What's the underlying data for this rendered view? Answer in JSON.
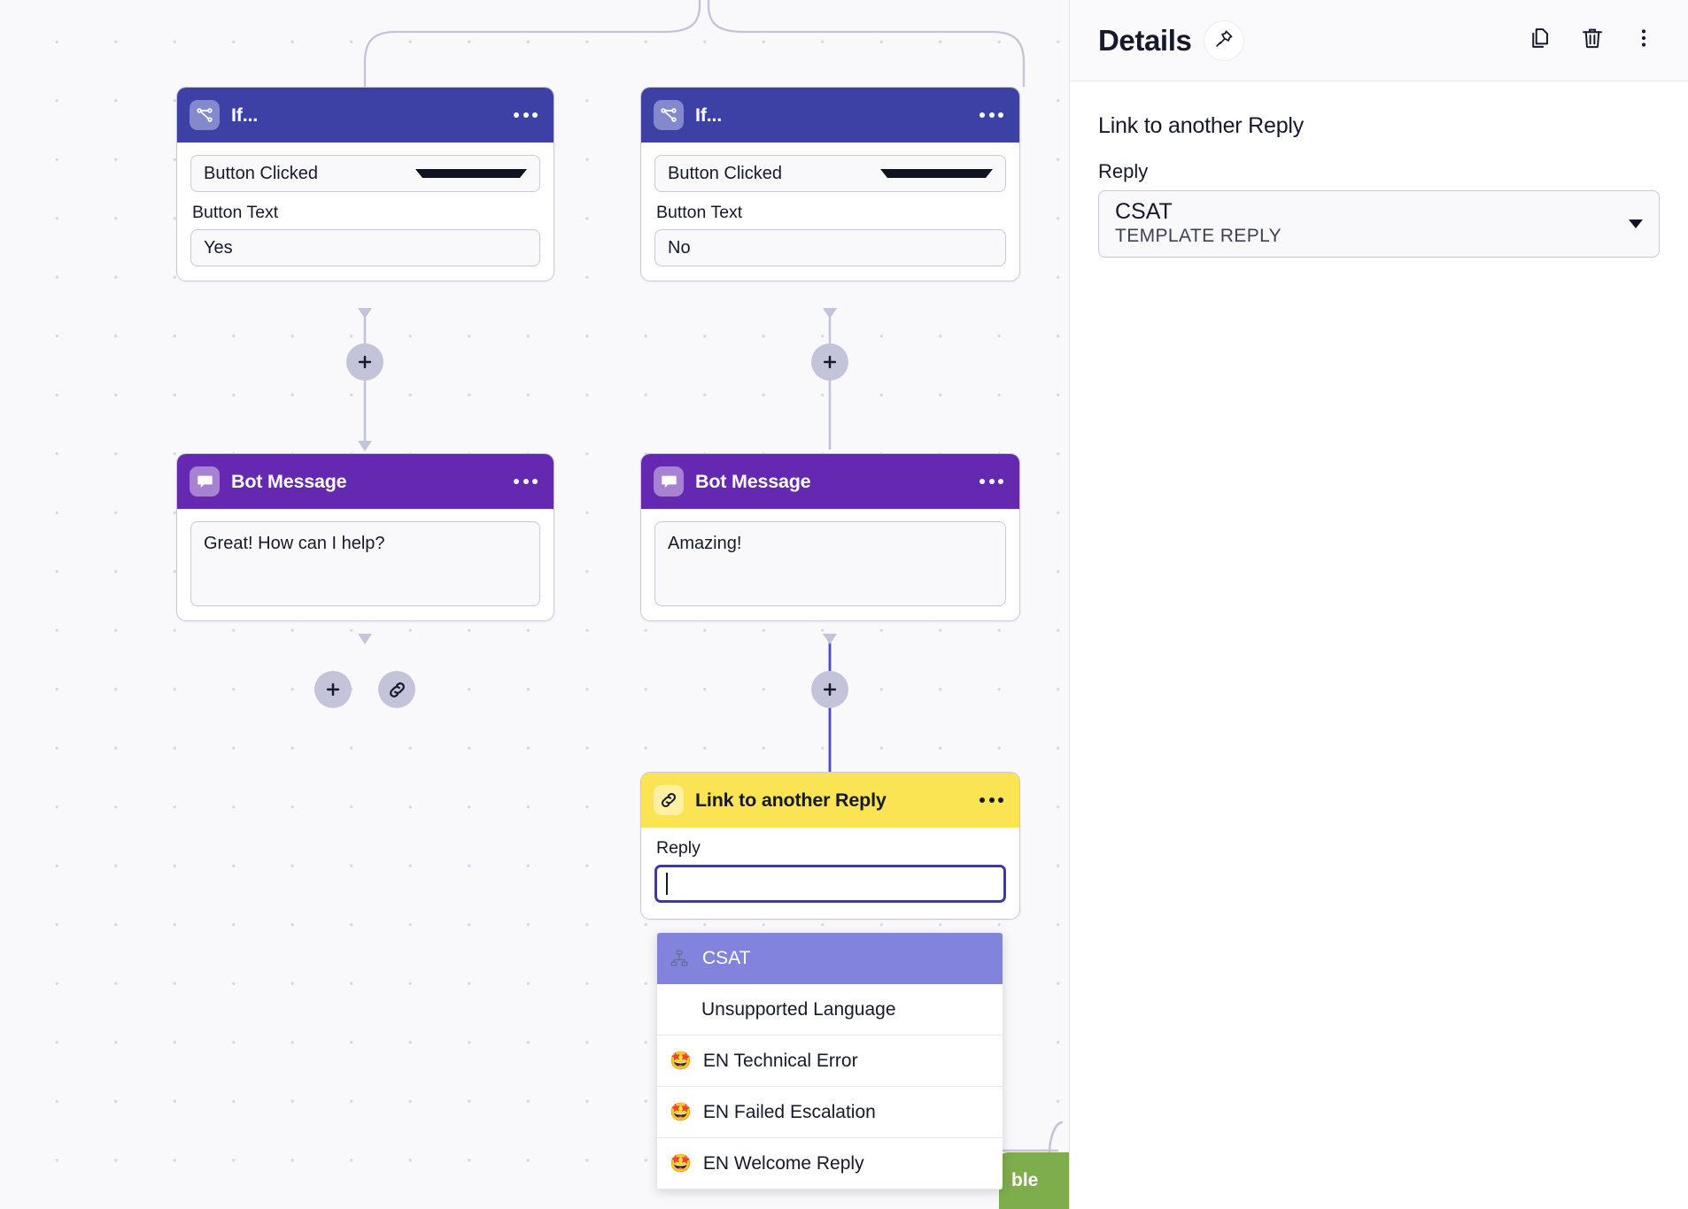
{
  "canvas": {
    "nodes": [
      {
        "id": "if-yes",
        "type": "if",
        "icon": "branch-icon",
        "title": "If...",
        "menu_icon": "more-horizontal-icon",
        "condition_value": "Button Clicked",
        "field_label": "Button Text",
        "field_value": "Yes"
      },
      {
        "id": "if-no",
        "type": "if",
        "icon": "branch-icon",
        "title": "If...",
        "menu_icon": "more-horizontal-icon",
        "condition_value": "Button Clicked",
        "field_label": "Button Text",
        "field_value": "No"
      },
      {
        "id": "bot-left",
        "type": "bot",
        "icon": "chat-bubble-icon",
        "title": "Bot Message",
        "menu_icon": "more-horizontal-icon",
        "message": "Great! How can I help?"
      },
      {
        "id": "bot-right",
        "type": "bot",
        "icon": "chat-bubble-icon",
        "title": "Bot Message",
        "menu_icon": "more-horizontal-icon",
        "message": "Amazing!"
      },
      {
        "id": "link-node",
        "type": "link",
        "icon": "link-icon",
        "title": "Link to another Reply",
        "menu_icon": "more-horizontal-icon",
        "field_label": "Reply",
        "field_value": ""
      }
    ],
    "add_buttons": [
      {
        "name": "add-node-button-left-1",
        "icon": "plus-icon"
      },
      {
        "name": "add-node-button-right-1",
        "icon": "plus-icon"
      },
      {
        "name": "add-node-button-left-2",
        "icon": "plus-icon"
      },
      {
        "name": "link-node-button-left",
        "icon": "link-icon"
      },
      {
        "name": "add-node-button-right-2",
        "icon": "plus-icon"
      }
    ],
    "green_node_label": "ble",
    "colors": {
      "if_header": "#3d41a6",
      "bot_header": "#6429b0",
      "link_header": "#fbe454",
      "green_node": "#7ead4c",
      "selected_option": "#8183dd",
      "focus_border": "#3d37b5",
      "edge": "#c3c3d9",
      "active_edge": "#4b49c9"
    }
  },
  "dropdown": {
    "options": [
      {
        "label": "CSAT",
        "icon": "sitemap-icon",
        "emoji": "",
        "selected": true
      },
      {
        "label": "Unsupported Language",
        "icon": "",
        "emoji": "",
        "selected": false
      },
      {
        "label": "EN Technical Error",
        "icon": "",
        "emoji": "🤩",
        "selected": false
      },
      {
        "label": "EN Failed Escalation",
        "icon": "",
        "emoji": "🤩",
        "selected": false
      },
      {
        "label": "EN Welcome Reply",
        "icon": "",
        "emoji": "🤩",
        "selected": false
      }
    ]
  },
  "panel": {
    "title": "Details",
    "pin_icon": "pin-icon",
    "actions": [
      {
        "name": "duplicate-button",
        "icon": "copy-icon"
      },
      {
        "name": "delete-button",
        "icon": "trash-icon"
      },
      {
        "name": "more-options-button",
        "icon": "more-vertical-icon"
      }
    ],
    "node_kind": "Link to another Reply",
    "reply_label": "Reply",
    "reply_value": "CSAT",
    "reply_subvalue": "TEMPLATE REPLY"
  }
}
